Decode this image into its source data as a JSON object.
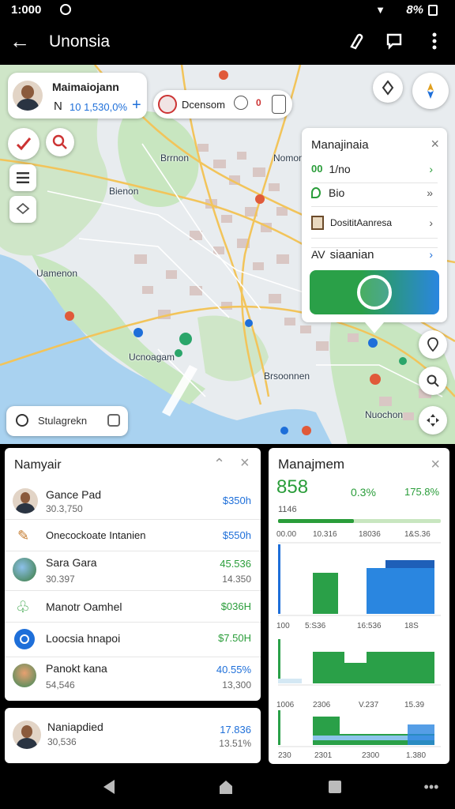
{
  "status_bar": {
    "time": "1:000",
    "battery": "8%"
  },
  "app_bar": {
    "title": "Unonsia"
  },
  "map": {
    "profile_card": {
      "name": "Maimaiojann",
      "stats": "10 1,530,0%",
      "prefix": "N",
      "plus": "+"
    },
    "search_pill": {
      "text": "Dcensom",
      "badge": "0"
    },
    "labels": [
      "Brrnon",
      "Nomon",
      "Bienon",
      "Uamenon",
      "Ucnoagam",
      "Brsoonnen",
      "Nuochon"
    ],
    "search_bar": {
      "text": "Stulagrekn"
    },
    "popup": {
      "title": "Manajinaia",
      "rows": [
        {
          "icon_text": "00",
          "label": "1/no"
        },
        {
          "icon_text": "",
          "label": "Bio"
        },
        {
          "icon_text": "",
          "label": "DosititAanresa"
        },
        {
          "icon_text": "AV",
          "label": "siaanian"
        }
      ]
    }
  },
  "left_panel": {
    "title": "Namyair",
    "items": [
      {
        "title": "Gance Pad",
        "sub": "30.3,750",
        "value": "$350h",
        "value_color": "#1e6fd9",
        "value2": ""
      },
      {
        "title": "Onecockoate Intanien",
        "sub": "",
        "value": "$550h",
        "value_color": "#1e6fd9",
        "value2": ""
      },
      {
        "title": "Sara Gara",
        "sub": "30.397",
        "value": "45.536",
        "value_color": "#2a9d3a",
        "value2": "14.350"
      },
      {
        "title": "Manotr Oamhel",
        "sub": "",
        "value": "$036H",
        "value_color": "#2a9d3a",
        "value2": ""
      },
      {
        "title": "Loocsia hnapoi",
        "sub": "",
        "value": "$7.50H",
        "value_color": "#2a9d3a",
        "value2": ""
      },
      {
        "title": "Panokt kana",
        "sub": "54,546",
        "value": "40.55%",
        "value_color": "#1e6fd9",
        "value2": "13,300"
      }
    ],
    "extra_item": {
      "title": "Naniapdied",
      "sub": "30,536",
      "value": "17.836",
      "value2": "13.51%"
    }
  },
  "right_panel": {
    "title": "Manajmem",
    "big_value": "858",
    "stat1": "0.3%",
    "stat2": "175.8%",
    "sub_value": "1146",
    "chart_rows": [
      {
        "ticks": [
          "00.00",
          "10.316",
          "18036",
          "1&S.36"
        ]
      },
      {
        "ticks": [
          "100",
          "5:S36",
          "16:536",
          "18S"
        ]
      },
      {
        "ticks": [
          "1006",
          "2306",
          "V.237",
          "15.39"
        ]
      },
      {
        "ticks": [
          "230",
          "2301",
          "2300",
          "1.380"
        ]
      }
    ]
  },
  "colors": {
    "accent_blue": "#1e6fd9",
    "accent_green": "#2a9d3a",
    "map_land": "#e8ecef",
    "map_green": "#c8e6c0",
    "map_water": "#a9d2f0"
  }
}
